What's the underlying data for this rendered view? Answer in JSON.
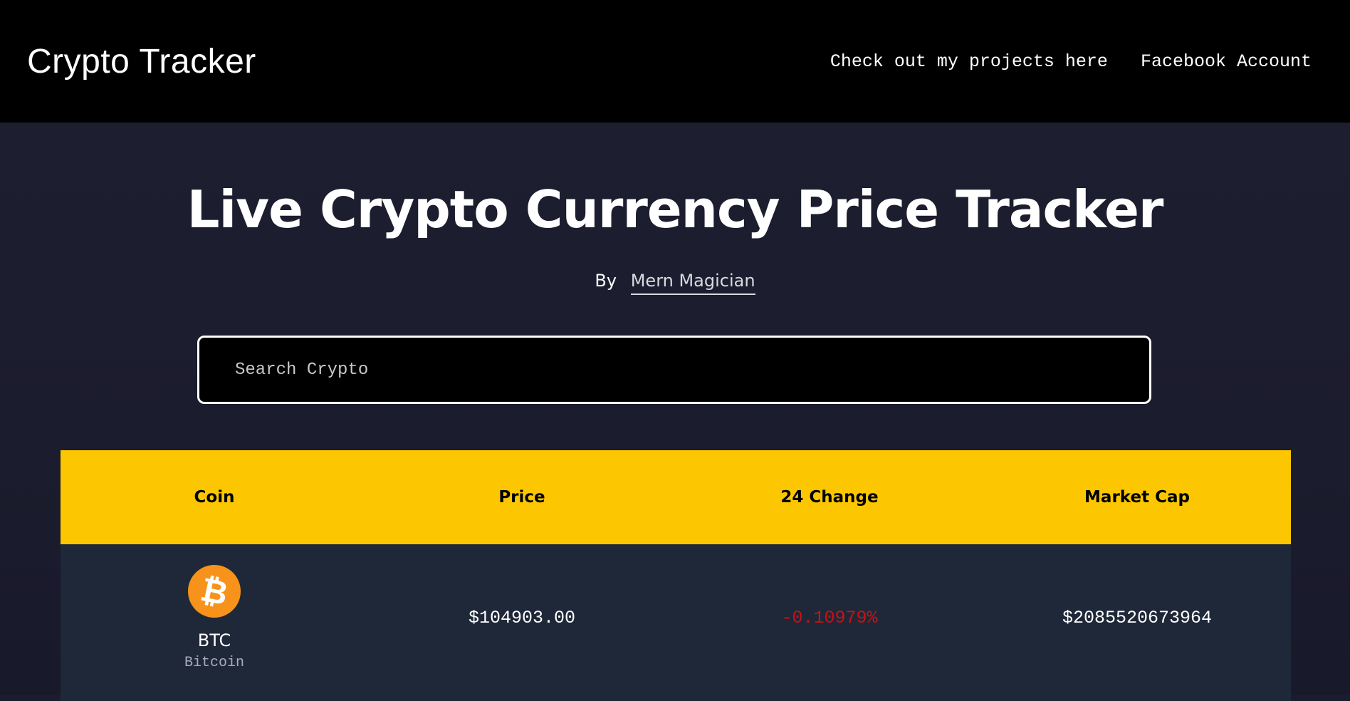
{
  "header": {
    "brand": "Crypto Tracker",
    "nav": [
      {
        "label": "Check out my projects here"
      },
      {
        "label": "Facebook Account"
      }
    ]
  },
  "hero": {
    "title": "Live Crypto Currency Price Tracker",
    "by_label": "By",
    "author": "Mern Magician"
  },
  "search": {
    "placeholder": "Search Crypto",
    "value": ""
  },
  "table": {
    "headers": [
      "Coin",
      "Price",
      "24 Change",
      "Market Cap"
    ],
    "rows": [
      {
        "logo_icon": "bitcoin-icon",
        "logo_glyph": "₿",
        "symbol": "BTC",
        "name": "Bitcoin",
        "price": "$104903.00",
        "change": "-0.10979%",
        "change_color": "#cc1111",
        "market_cap": "$2085520673964"
      }
    ]
  },
  "colors": {
    "header_bg": "#000000",
    "page_bg": "#1b1c2e",
    "table_header_bg": "#fcc700",
    "row_bg": "#1f2839",
    "bitcoin_orange": "#f7931a",
    "negative": "#cc1111"
  }
}
